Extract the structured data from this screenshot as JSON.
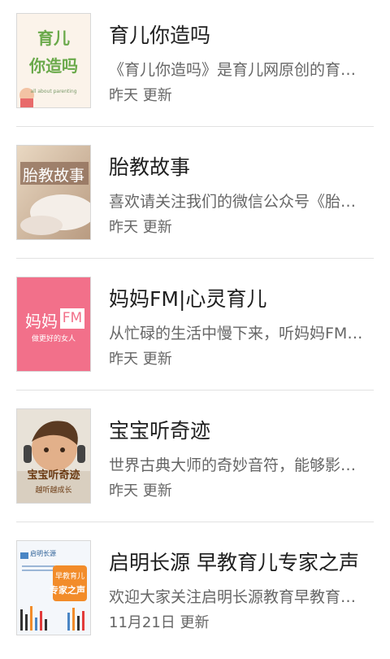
{
  "items": [
    {
      "title": "育儿你造吗",
      "description": "《育儿你造吗》是育儿网原创的育儿节目",
      "updated": "昨天 更新",
      "cover_line1": "育儿",
      "cover_line2": "你造吗",
      "cover_sub": "all about parenting"
    },
    {
      "title": "胎教故事",
      "description": "喜欢请关注我们的微信公众号《胎教故事》",
      "updated": "昨天 更新",
      "cover_text": "胎教故事"
    },
    {
      "title": "妈妈FM|心灵育儿",
      "description": "从忙碌的生活中慢下来，听妈妈FM心灵育儿",
      "updated": "昨天 更新",
      "cover_main": "妈妈",
      "cover_badge": "FM",
      "cover_sub": "做更好的女人"
    },
    {
      "title": "宝宝听奇迹",
      "description": "世界古典大师的奇妙音符，能够影响宝宝",
      "updated": "昨天 更新",
      "cover_text": "宝宝听奇迹",
      "cover_sub": "越听越成长"
    },
    {
      "title": "启明长源 早教育儿专家之声",
      "description": "欢迎大家关注启明长源教育早教育儿专家之声",
      "updated": "11月21日 更新",
      "cover_logo": "启明长源",
      "cover_line1": "早教育儿",
      "cover_line2": "专家之声"
    }
  ],
  "colors": {
    "title": "#1f1f1f",
    "meta": "#666666",
    "divider": "#e2e2e2",
    "fm_pink": "#f2708a"
  }
}
